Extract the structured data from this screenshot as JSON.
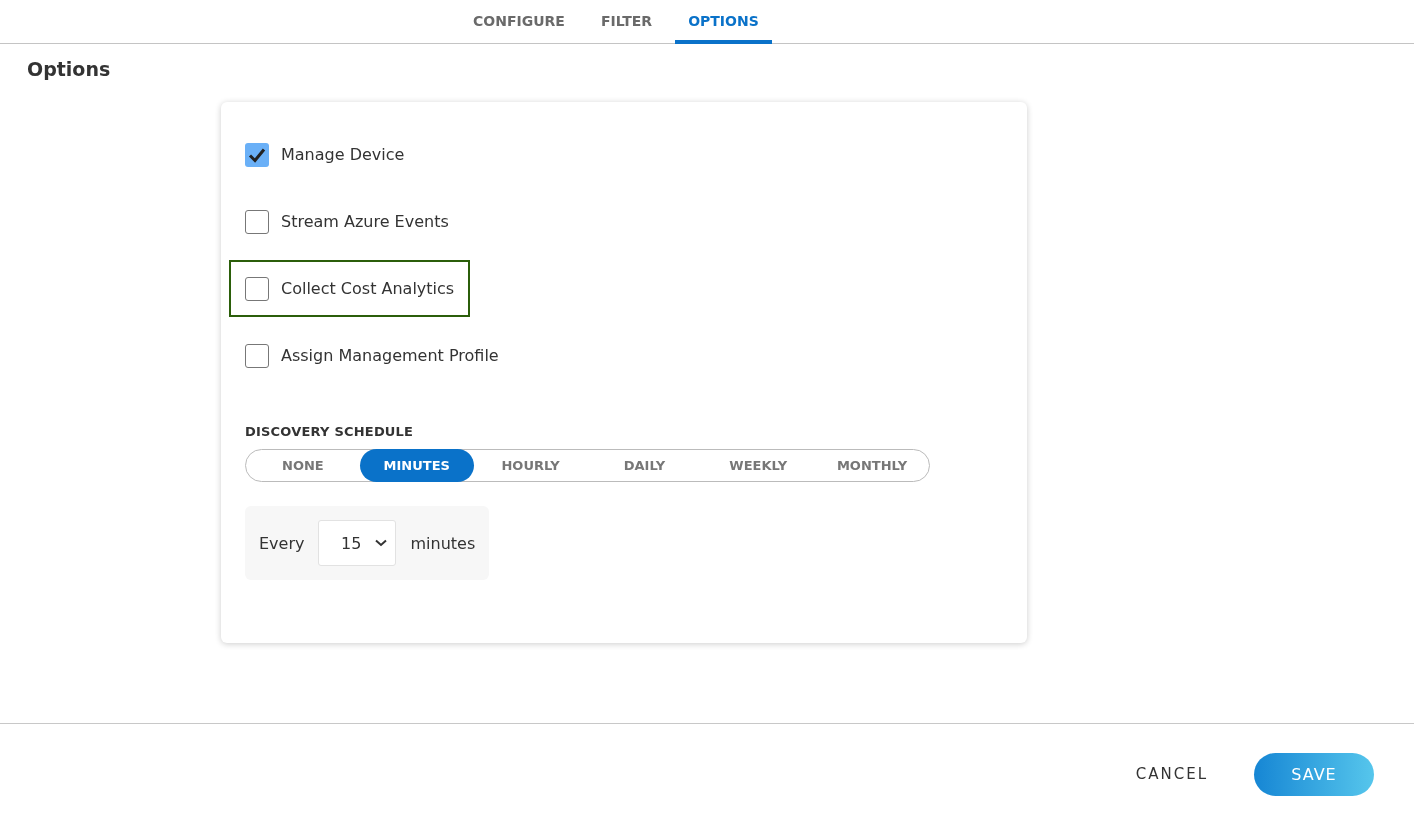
{
  "tabs": [
    {
      "label": "CONFIGURE",
      "selected": false
    },
    {
      "label": "FILTER",
      "selected": false
    },
    {
      "label": "OPTIONS",
      "selected": true
    }
  ],
  "heading": "Options",
  "options": [
    {
      "label": "Manage Device",
      "checked": true,
      "focused": false
    },
    {
      "label": "Stream Azure Events",
      "checked": false,
      "focused": false
    },
    {
      "label": "Collect Cost Analytics",
      "checked": false,
      "focused": true
    },
    {
      "label": "Assign Management Profile",
      "checked": false,
      "focused": false
    }
  ],
  "schedule": {
    "title": "DISCOVERY SCHEDULE",
    "choices": [
      {
        "label": "NONE",
        "selected": false
      },
      {
        "label": "MINUTES",
        "selected": true
      },
      {
        "label": "HOURLY",
        "selected": false
      },
      {
        "label": "DAILY",
        "selected": false
      },
      {
        "label": "WEEKLY",
        "selected": false
      },
      {
        "label": "MONTHLY",
        "selected": false
      }
    ],
    "interval": {
      "prefix": "Every",
      "value": "15",
      "suffix": "minutes"
    }
  },
  "footer": {
    "cancel": "CANCEL",
    "save": "SAVE"
  }
}
